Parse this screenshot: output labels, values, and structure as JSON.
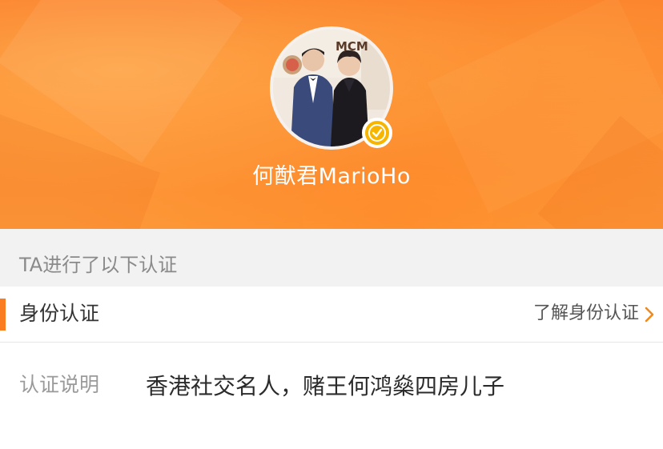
{
  "profile": {
    "username": "何猷君MarioHo",
    "avatar_icon": "profile-photo",
    "avatar_sign_text": "MCM",
    "verified_icon": "verified-checkmark-icon",
    "verified_color": "#f7b500"
  },
  "section": {
    "title": "TA进行了以下认证"
  },
  "verification": {
    "type_label": "身份认证",
    "learn_more_label": "了解身份认证",
    "learn_more_icon": "chevron-right-icon",
    "accent_color": "#fa7d1f"
  },
  "description": {
    "label": "认证说明",
    "text": "香港社交名人，赌王何鸿燊四房儿子"
  },
  "colors": {
    "header_orange": "#fb7c2a",
    "chevron": "#f08a1c"
  }
}
